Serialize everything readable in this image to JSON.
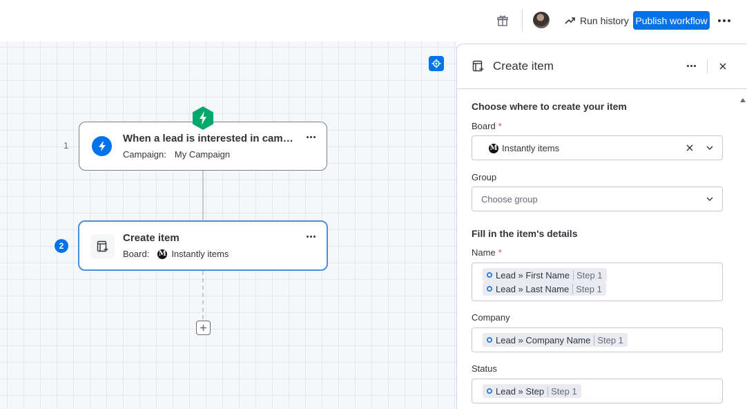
{
  "topbar": {
    "gift_icon": "gift-icon",
    "run_history_label": "Run history",
    "publish_label": "Publish workflow",
    "more_icon": "more-horizontal-icon",
    "accent": "#0073ea"
  },
  "canvas": {
    "steps": [
      {
        "number": "1",
        "title": "When a lead is interested in campaign",
        "sub_label": "Campaign:",
        "sub_value": "My Campaign",
        "icon": "lightning-icon"
      },
      {
        "number": "2",
        "title": "Create item",
        "sub_label": "Board:",
        "sub_value": "Instantly items",
        "icon": "create-item-icon",
        "selected": true
      }
    ]
  },
  "panel": {
    "title": "Create item",
    "section1_title": "Choose where to create your item",
    "board_label": "Board",
    "board_value": "Instantly items",
    "group_label": "Group",
    "group_placeholder": "Choose group",
    "section2_title": "Fill in the item's details",
    "name_label": "Name",
    "name_chips": [
      {
        "text": "Lead » First Name",
        "step": "Step 1"
      },
      {
        "text": "Lead » Last Name",
        "step": "Step 1"
      }
    ],
    "company_label": "Company",
    "company_chip": {
      "text": "Lead » Company Name",
      "step": "Step 1"
    },
    "status_label": "Status",
    "status_chip": {
      "text": "Lead » Step",
      "step": "Step 1"
    },
    "required_mark": "*"
  }
}
